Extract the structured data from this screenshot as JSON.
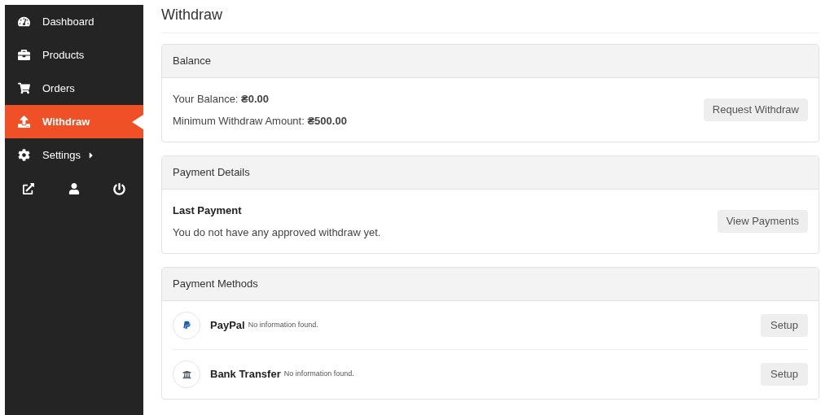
{
  "sidebar": {
    "items": [
      {
        "label": "Dashboard",
        "selected": false,
        "has_submenu": false
      },
      {
        "label": "Products",
        "selected": false,
        "has_submenu": false
      },
      {
        "label": "Orders",
        "selected": false,
        "has_submenu": false
      },
      {
        "label": "Withdraw",
        "selected": true,
        "has_submenu": false
      },
      {
        "label": "Settings",
        "selected": false,
        "has_submenu": true
      }
    ]
  },
  "page_title": "Withdraw",
  "balance": {
    "title": "Balance",
    "lines": [
      "Your Balance: **₴0.00**",
      "Minimum Withdraw Amount: **₴500.00**"
    ],
    "button": "Request Withdraw"
  },
  "payment_details": {
    "title": "Payment Details",
    "heading": "Last Payment",
    "text": "You do not have any approved withdraw yet.",
    "button": "View Payments"
  },
  "payment_methods": {
    "title": "Payment Methods",
    "methods": [
      {
        "name": "PayPal",
        "status": "No information found.",
        "button": "Setup"
      },
      {
        "name": "Bank Transfer",
        "status": "No information found.",
        "button": "Setup"
      }
    ]
  }
}
